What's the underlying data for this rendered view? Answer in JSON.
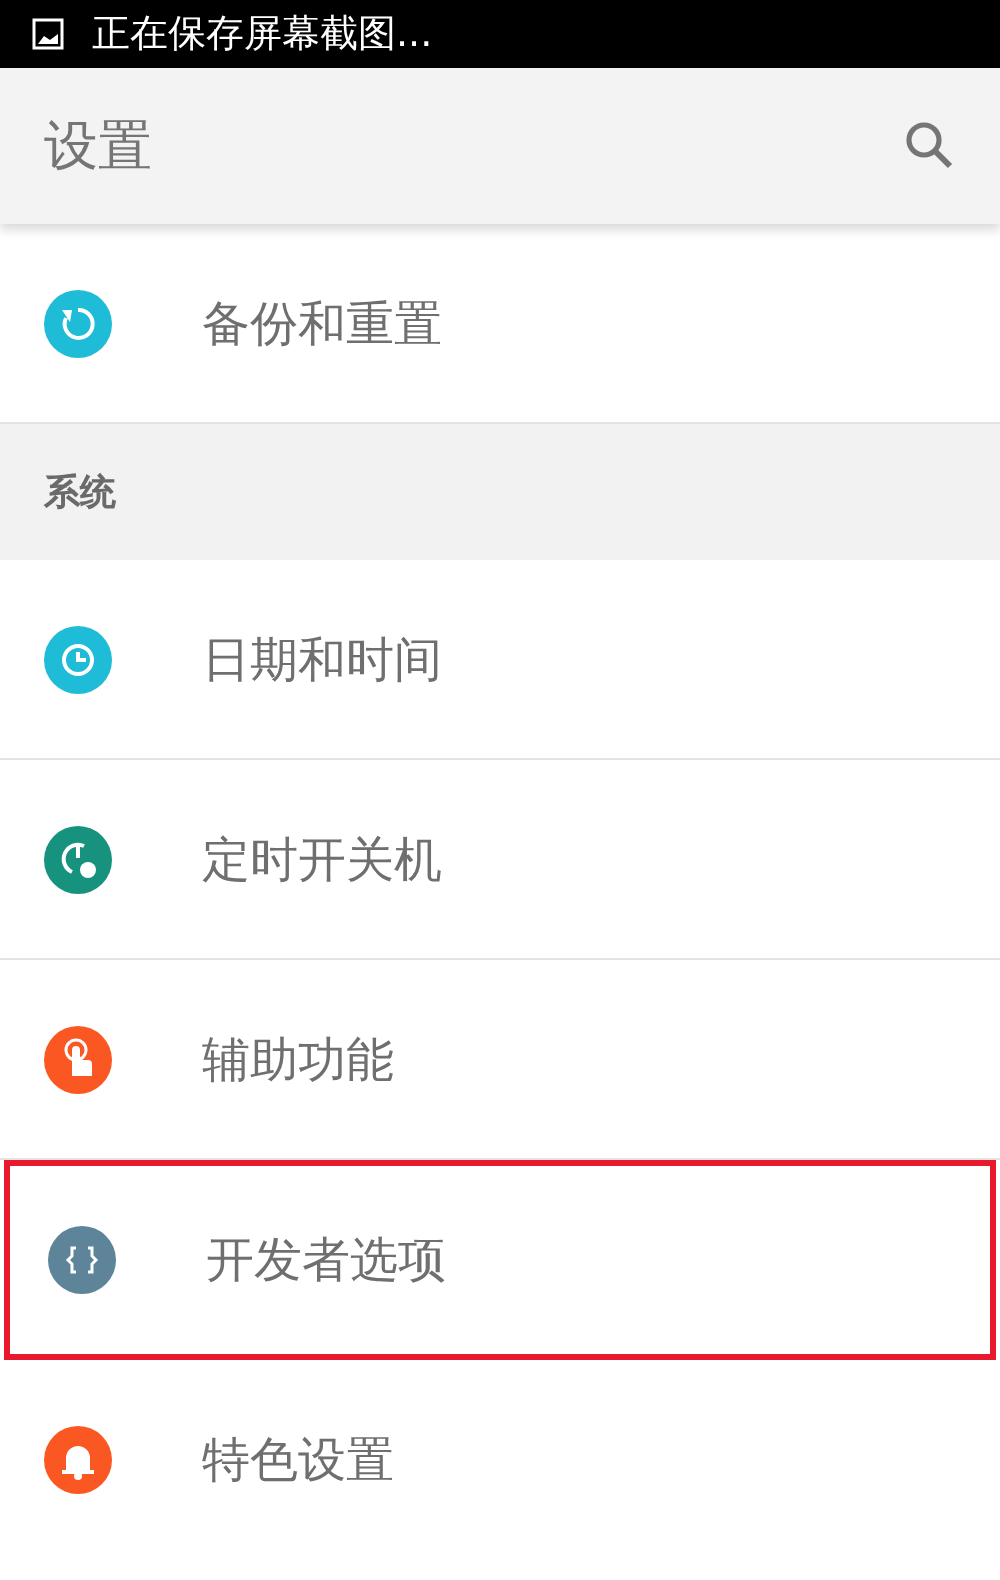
{
  "status_bar": {
    "notification": "正在保存屏幕截图..."
  },
  "app_bar": {
    "title": "设置"
  },
  "items": [
    {
      "label": "备份和重置",
      "color": "#1ebcd6",
      "highlighted": false
    }
  ],
  "sections": [
    {
      "header": "系统",
      "items": [
        {
          "label": "日期和时间",
          "color": "#1ebcd6",
          "highlighted": false
        },
        {
          "label": "定时开关机",
          "color": "#16927e",
          "highlighted": false
        },
        {
          "label": "辅助功能",
          "color": "#fb5722",
          "highlighted": false
        },
        {
          "label": "开发者选项",
          "color": "#5d8499",
          "highlighted": true
        },
        {
          "label": "特色设置",
          "color": "#fb5722",
          "highlighted": false
        }
      ]
    }
  ]
}
